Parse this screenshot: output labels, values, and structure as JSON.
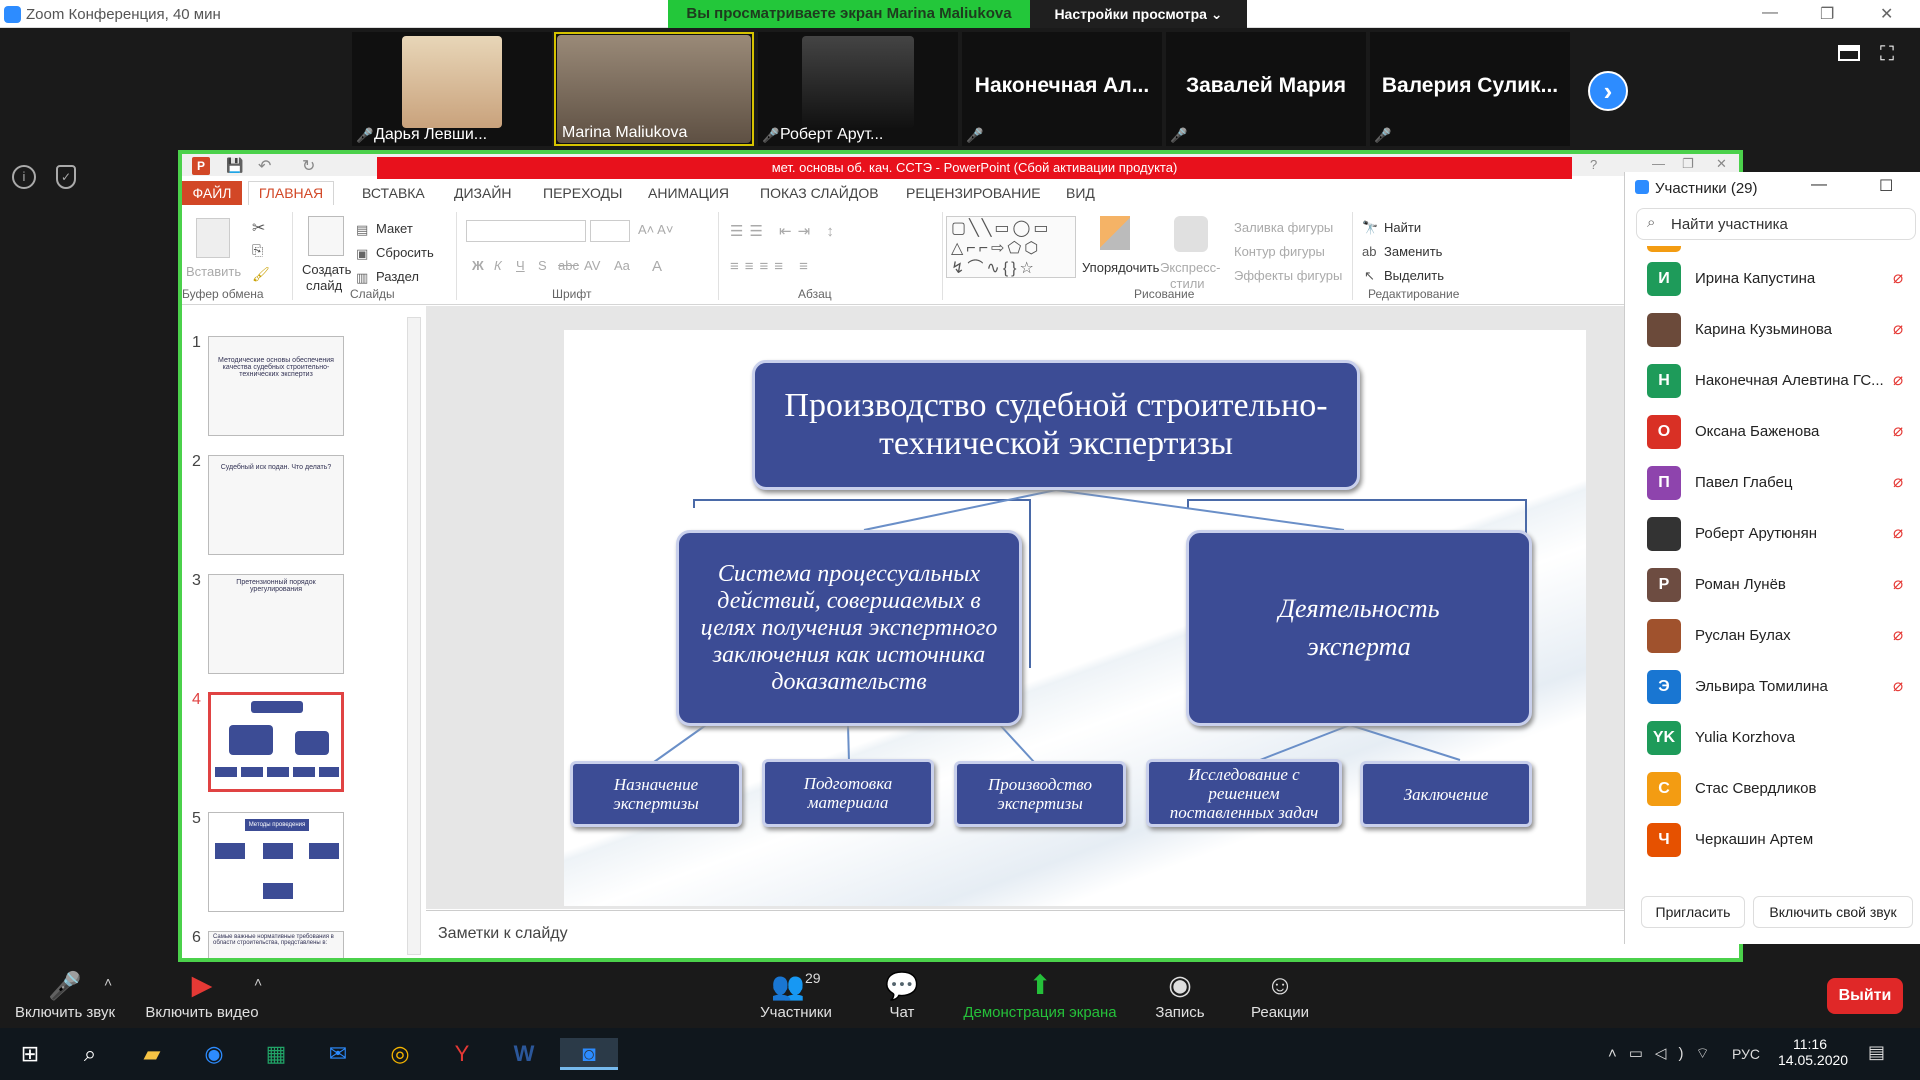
{
  "window": {
    "title": "Zoom Конференция, 40 мин"
  },
  "banner": {
    "text": "Вы просматриваете экран Marina Maliukova",
    "view_options": "Настройки просмотра ⌄"
  },
  "videos": [
    {
      "name": "Дарья Левши..."
    },
    {
      "name": "Marina Maliukova"
    },
    {
      "name": "Роберт Арут..."
    },
    {
      "name": "Наконечная  Ал..."
    },
    {
      "name": "Завалей Мария"
    },
    {
      "name": "Валерия  Сулик..."
    }
  ],
  "ppt": {
    "title": "мет. основы об. кач. СCТЭ -  PowerPoint (Сбой активации продукта)",
    "tabs": [
      "ФАЙЛ",
      "ГЛАВНАЯ",
      "ВСТАВКА",
      "ДИЗАЙН",
      "ПЕРЕХОДЫ",
      "АНИМАЦИЯ",
      "ПОКАЗ СЛАЙДОВ",
      "РЕЦЕНЗИРОВАНИЕ",
      "ВИД"
    ],
    "ribbon": {
      "paste": "Вставить",
      "new_slide_1": "Создать",
      "new_slide_2": "слайд",
      "layout": "Макет",
      "reset": "Сбросить",
      "section": "Раздел",
      "arrange": "Упорядочить",
      "quick_styles_1": "Экспресс-",
      "quick_styles_2": "стили",
      "shape_fill": "Заливка фигуры",
      "shape_outline": "Контур фигуры",
      "shape_effects": "Эффекты фигуры",
      "find": "Найти",
      "replace": "Заменить",
      "select": "Выделить",
      "groups": [
        "Буфер обмена",
        "Слайды",
        "Шрифт",
        "Абзац",
        "Рисование",
        "Редактирование"
      ]
    },
    "thumbs": [
      {
        "num": "1",
        "text": "Методические основы обеспечения качества судебных строительно-технических экспертиз"
      },
      {
        "num": "2",
        "text": "Судебный иск подан. Что делать?"
      },
      {
        "num": "3",
        "text": "Претензионный порядок урегулирования"
      },
      {
        "num": "4",
        "text": ""
      },
      {
        "num": "5",
        "text": "Методы проведения ССТЭ"
      },
      {
        "num": "6",
        "text": "Самые важные нормативные требования в области строительства, представлены в:"
      }
    ],
    "notes": "Заметки к слайду",
    "slide": {
      "title": "Производство судебной строительно-технической экспертизы",
      "left": "Система процессуальных действий, совершаемых в целях получения экспертного заключения как источника доказательств",
      "right": "Деятельность эксперта",
      "leaves": [
        "Назначение экспертизы",
        "Подготовка материала",
        "Производство экспертизы",
        "Исследование с решением поставленных задач",
        "Заключение"
      ]
    }
  },
  "participants": {
    "header": "Участники (29)",
    "search_placeholder": "Найти участника",
    "list": [
      {
        "initial": "И",
        "name": "Ирина Капустина",
        "color": "#1e9b5a"
      },
      {
        "initial": "",
        "name": "Карина Кузьминова",
        "color": "#6b4a3a"
      },
      {
        "initial": "Н",
        "name": "Наконечная Алевтина ГС...",
        "color": "#1e9b5a"
      },
      {
        "initial": "О",
        "name": "Оксана Баженова",
        "color": "#d93025"
      },
      {
        "initial": "П",
        "name": "Павел Глабец",
        "color": "#8e44ad"
      },
      {
        "initial": "",
        "name": "Роберт Арутюнян",
        "color": "#333"
      },
      {
        "initial": "Р",
        "name": "Роман Лунёв",
        "color": "#6d4c41"
      },
      {
        "initial": "",
        "name": "Руслан Булах",
        "color": "#a0522d"
      },
      {
        "initial": "Э",
        "name": "Эльвира Томилина",
        "color": "#1976d2"
      },
      {
        "initial": "YK",
        "name": "Yulia Korzhova",
        "color": "#1e9b5a"
      },
      {
        "initial": "С",
        "name": "Стас Свердликов",
        "color": "#f39c12"
      },
      {
        "initial": "Ч",
        "name": "Черкашин Артем",
        "color": "#e65100"
      }
    ],
    "invite": "Пригласить",
    "unmute": "Включить свой звук"
  },
  "toolbar": {
    "unmute": "Включить звук",
    "start_video": "Включить видео",
    "participants": "Участники",
    "participants_count": "29",
    "chat": "Чат",
    "share": "Демонстрация экрана",
    "record": "Запись",
    "reactions": "Реакции",
    "leave": "Выйти"
  },
  "taskbar": {
    "lang": "РУС",
    "time": "11:16",
    "date": "14.05.2020"
  }
}
